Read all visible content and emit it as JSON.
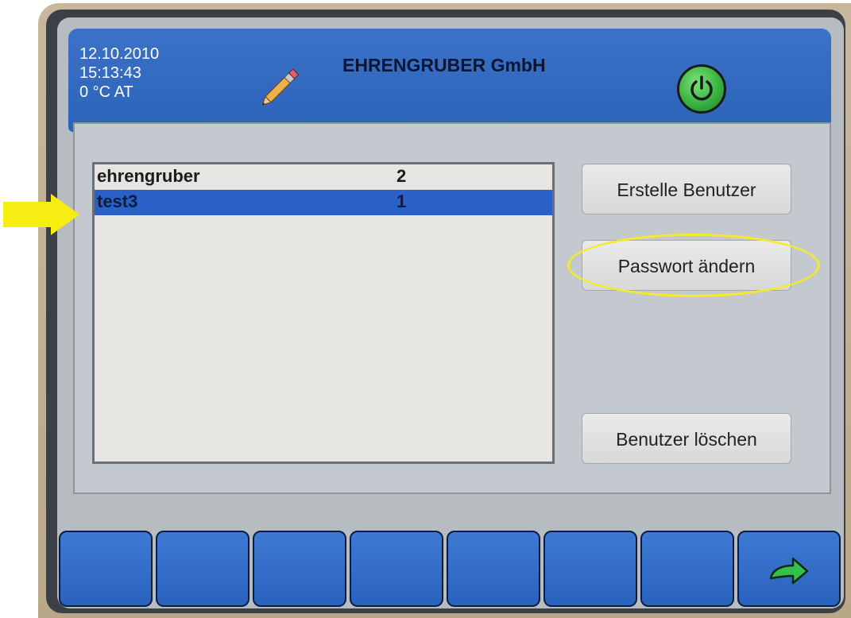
{
  "header": {
    "date": "12.10.2010",
    "time": "15:13:43",
    "temperature": "0 °C AT",
    "company": "EHRENGRUBER GmbH",
    "accent_color": "#2b63b8",
    "edit_icon": "pencil-icon",
    "power_icon": "power-icon"
  },
  "user_list": {
    "rows": [
      {
        "name": "ehrengruber",
        "level": "2",
        "selected": false
      },
      {
        "name": "test3",
        "level": "1",
        "selected": true
      }
    ],
    "selection_color": "#2a61c8"
  },
  "actions": {
    "create_user": "Erstelle Benutzer",
    "change_password": "Passwort ändern",
    "delete_user": "Benutzer löschen"
  },
  "function_keys": {
    "count": 8,
    "last_icon": "back-arrow-icon"
  },
  "annotations": {
    "arrow_color": "#f6ee12",
    "ellipse_color": "#f4ea2c"
  }
}
